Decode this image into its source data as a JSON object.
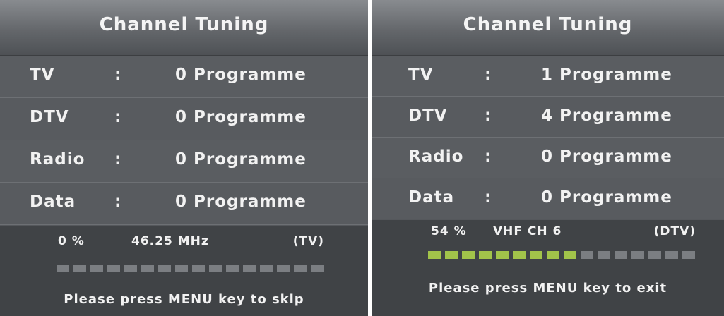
{
  "panels": [
    {
      "title": "Channel Tuning",
      "rows": [
        {
          "label": "TV",
          "colon": ":",
          "value": "0 Programme"
        },
        {
          "label": "DTV",
          "colon": ":",
          "value": "0 Programme"
        },
        {
          "label": "Radio",
          "colon": ":",
          "value": "0 Programme"
        },
        {
          "label": "Data",
          "colon": ":",
          "value": "0 Programme"
        }
      ],
      "status": {
        "percent": "0  %",
        "frequency": "46.25 MHz",
        "mode": "(TV)",
        "progress_percent": 0,
        "segments_total": 16
      },
      "hint": "Please press MENU key to skip"
    },
    {
      "title": "Channel Tuning",
      "rows": [
        {
          "label": "TV",
          "colon": ":",
          "value": "1 Programme"
        },
        {
          "label": "DTV",
          "colon": ":",
          "value": "4 Programme"
        },
        {
          "label": "Radio",
          "colon": ":",
          "value": "0 Programme"
        },
        {
          "label": "Data",
          "colon": ":",
          "value": "0 Programme"
        }
      ],
      "status": {
        "percent": "54 %",
        "frequency": "VHF  CH  6",
        "mode": "(DTV)",
        "progress_percent": 54,
        "segments_total": 16
      },
      "hint": "Please press MENU key to exit"
    }
  ],
  "colors": {
    "panel_background": "#55585c",
    "status_background": "#404346",
    "progress_on": "#a2c34a",
    "progress_off": "#7b7e82",
    "text": "#f2f2f2"
  }
}
